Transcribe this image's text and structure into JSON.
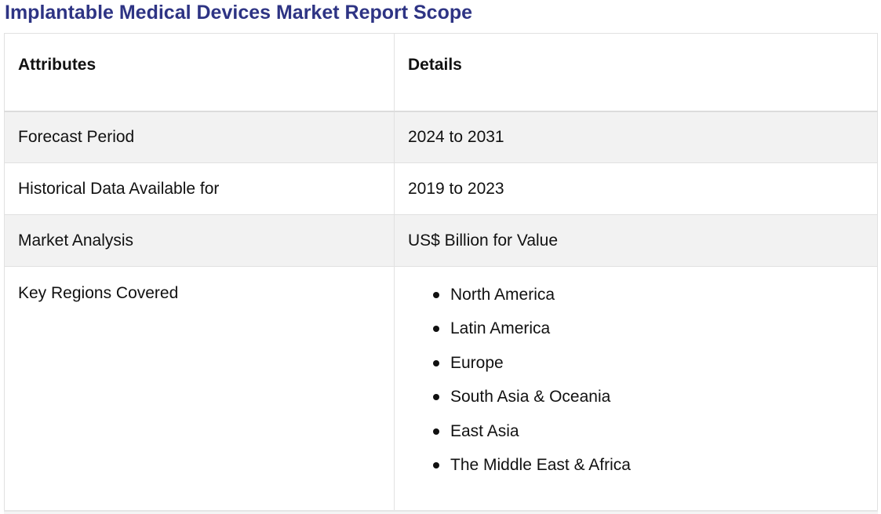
{
  "page": {
    "title": "Implantable Medical Devices Market Report Scope",
    "title_color": "#2e3484"
  },
  "table": {
    "headers": {
      "attributes": "Attributes",
      "details": "Details"
    },
    "rows": [
      {
        "attribute": "Forecast Period",
        "detail": "2024 to 2031"
      },
      {
        "attribute": "Historical Data Available for",
        "detail": "2019 to 2023"
      },
      {
        "attribute": "Market Analysis",
        "detail": "US$ Billion for Value"
      },
      {
        "attribute": "Key Regions Covered"
      }
    ],
    "regions": [
      "North America",
      "Latin America",
      "Europe",
      "South Asia & Oceania",
      "East Asia",
      "The Middle East & Africa"
    ],
    "shaded_row_color": "#f2f2f2"
  }
}
